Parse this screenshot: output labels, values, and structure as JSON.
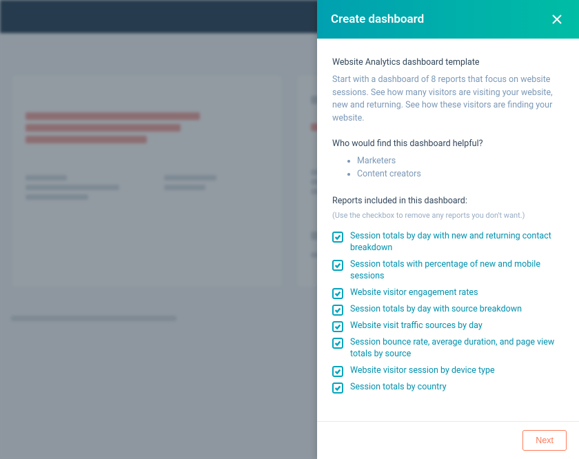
{
  "drawer": {
    "title": "Create dashboard",
    "template_name": "Website Analytics dashboard template",
    "template_description": "Start with a dashboard of 8 reports that focus on website sessions. See how many visitors are visiting your website, new and returning. See how these visitors are finding your website.",
    "helpful_heading": "Who would find this dashboard helpful?",
    "helpful_list": [
      "Marketers",
      "Content creators"
    ],
    "reports_heading": "Reports included in this dashboard:",
    "reports_note": "(Use the checkbox to remove any reports you don't want.)",
    "reports": [
      {
        "checked": true,
        "label": "Session totals by day with new and returning contact breakdown"
      },
      {
        "checked": true,
        "label": "Session totals with percentage of new and mobile sessions"
      },
      {
        "checked": true,
        "label": "Website visitor engagement rates"
      },
      {
        "checked": true,
        "label": "Session totals by day with source breakdown"
      },
      {
        "checked": true,
        "label": "Website visit traffic sources by day"
      },
      {
        "checked": true,
        "label": "Session bounce rate, average duration, and page view totals by source"
      },
      {
        "checked": true,
        "label": "Website visitor session by device type"
      },
      {
        "checked": true,
        "label": "Session totals by country"
      }
    ],
    "next_label": "Next"
  }
}
